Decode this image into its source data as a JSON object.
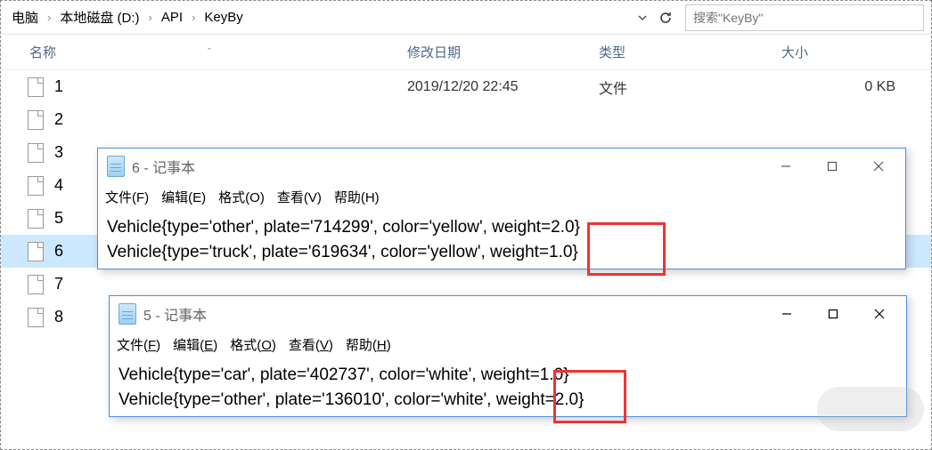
{
  "breadcrumb": {
    "items": [
      "电脑",
      "本地磁盘 (D:)",
      "API",
      "KeyBy"
    ]
  },
  "search": {
    "placeholder": "搜索\"KeyBy\""
  },
  "columns": {
    "name": "名称",
    "date": "修改日期",
    "type": "类型",
    "size": "大小"
  },
  "files": [
    {
      "name": "1",
      "date": "2019/12/20 22:45",
      "type": "文件",
      "size": "0 KB"
    },
    {
      "name": "2",
      "date": "",
      "type": "",
      "size": ""
    },
    {
      "name": "3",
      "date": "",
      "type": "",
      "size": ""
    },
    {
      "name": "4",
      "date": "",
      "type": "",
      "size": ""
    },
    {
      "name": "5",
      "date": "",
      "type": "",
      "size": ""
    },
    {
      "name": "6",
      "date": "",
      "type": "",
      "size": ""
    },
    {
      "name": "7",
      "date": "",
      "type": "",
      "size": ""
    },
    {
      "name": "8",
      "date": "",
      "type": "",
      "size": ""
    }
  ],
  "selected_file_index": 5,
  "notepad6": {
    "title": "6 - 记事本",
    "menu": {
      "file": "文件(F)",
      "edit": "编辑(E)",
      "format": "格式(O)",
      "view": "查看(V)",
      "help": "帮助(H)"
    },
    "lines": [
      "Vehicle{type='other', plate='714299', color='yellow', weight=2.0}",
      "Vehicle{type='truck', plate='619634', color='yellow', weight=1.0}"
    ],
    "highlight_word": "yellow"
  },
  "notepad5": {
    "title": "5 - 记事本",
    "menu": {
      "file": "文件(F)",
      "edit": "编辑(E)",
      "format": "格式(O)",
      "view": "查看(V)",
      "help": "帮助(H)"
    },
    "lines": [
      "Vehicle{type='car', plate='402737', color='white', weight=1.0}",
      "Vehicle{type='other', plate='136010', color='white', weight=2.0}"
    ],
    "highlight_word": "white"
  }
}
